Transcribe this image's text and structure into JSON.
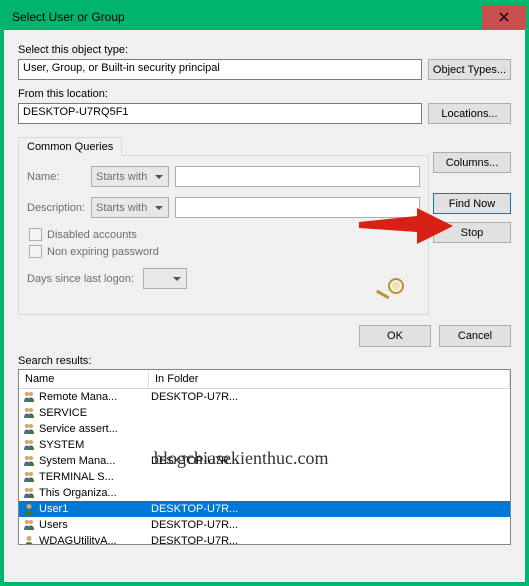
{
  "title": "Select User or Group",
  "labels": {
    "objectType": "Select this object type:",
    "fromLocation": "From this location:",
    "searchResults": "Search results:",
    "name": "Name:",
    "description": "Description:",
    "days": "Days since last logon:",
    "disabled": "Disabled accounts",
    "nonExpiring": "Non expiring password"
  },
  "fields": {
    "objectType": "User, Group, or Built-in security principal",
    "location": "DESKTOP-U7RQ5F1",
    "startsWith": "Starts with"
  },
  "buttons": {
    "objectTypes": "Object Types...",
    "locations": "Locations...",
    "columns": "Columns...",
    "findNow": "Find Now",
    "stop": "Stop",
    "ok": "OK",
    "cancel": "Cancel"
  },
  "tab": "Common Queries",
  "columns": {
    "name": "Name",
    "folder": "In Folder"
  },
  "results": [
    {
      "icon": "group",
      "name": "Remote Mana...",
      "folder": "DESKTOP-U7R..."
    },
    {
      "icon": "group",
      "name": "SERVICE",
      "folder": ""
    },
    {
      "icon": "group",
      "name": "Service assert...",
      "folder": ""
    },
    {
      "icon": "group",
      "name": "SYSTEM",
      "folder": ""
    },
    {
      "icon": "group",
      "name": "System Mana...",
      "folder": "DESKTOP-U7R..."
    },
    {
      "icon": "group",
      "name": "TERMINAL S...",
      "folder": ""
    },
    {
      "icon": "group",
      "name": "This Organiza...",
      "folder": ""
    },
    {
      "icon": "user",
      "name": "User1",
      "folder": "DESKTOP-U7R...",
      "selected": true
    },
    {
      "icon": "group",
      "name": "Users",
      "folder": "DESKTOP-U7R..."
    },
    {
      "icon": "user",
      "name": "WDAGUtilityA...",
      "folder": "DESKTOP-U7R..."
    }
  ],
  "watermark": "blogchiasekienthuc.com"
}
